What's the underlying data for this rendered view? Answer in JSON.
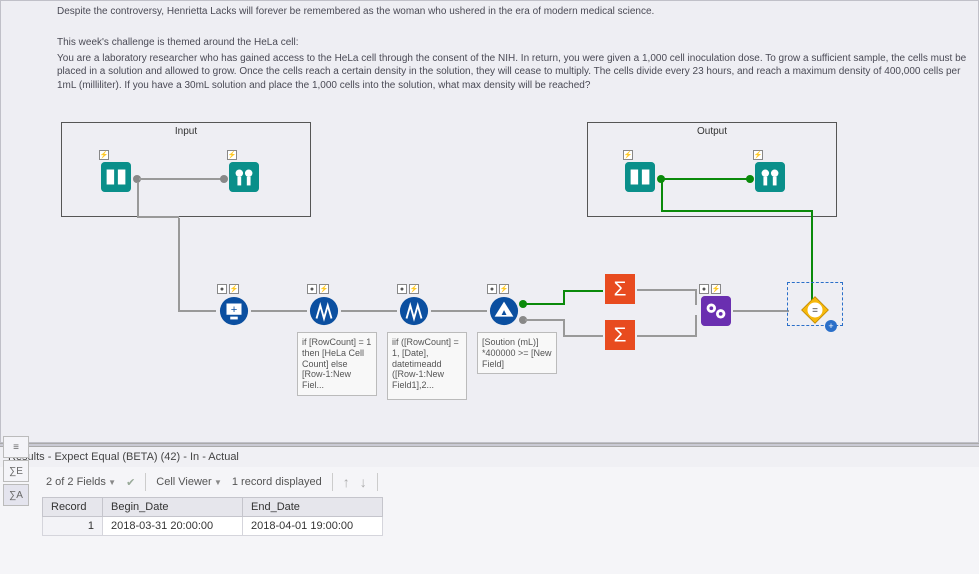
{
  "description": {
    "line1": "Despite the controversy, Henrietta Lacks will forever be remembered as the woman who ushered in the era of modern medical science.",
    "line2": "This week's challenge is themed around the HeLa cell:",
    "line3": "You are a laboratory researcher who has gained access to the HeLa cell through the consent of the NIH. In return, you were given a 1,000 cell inoculation dose. To grow a sufficient sample, the cells must be placed in a solution and allowed to grow. Once the cells reach a certain density in the solution, they will cease to multiply. The cells divide every 23 hours, and reach a maximum density of 400,000 cells per 1mL (milliliter). If you have a 30mL solution and place the 1,000 cells into the solution, what max density will be reached?"
  },
  "canvas": {
    "input_label": "Input",
    "output_label": "Output",
    "annotations": {
      "a1": "if [RowCount] = 1 then [HeLa Cell Count] else [Row-1:New Fiel...",
      "a2": "iif ([RowCount] = 1, [Date], datetimeadd ([Row-1:New Field1],2...",
      "a3": "[Soution (mL)] *400000 >= [New Field]"
    }
  },
  "results": {
    "title": "Results - Expect Equal (BETA) (42) - In - Actual",
    "fields_summary": "2 of 2 Fields",
    "cell_viewer": "Cell Viewer",
    "record_count": "1 record displayed",
    "side_sigma": "∑E",
    "side_a": "∑A",
    "columns": {
      "c0": "Record",
      "c1": "Begin_Date",
      "c2": "End_Date"
    },
    "row1": {
      "record": "1",
      "begin": "2018-03-31 20:00:00",
      "end": "2018-04-01 19:00:00"
    }
  }
}
